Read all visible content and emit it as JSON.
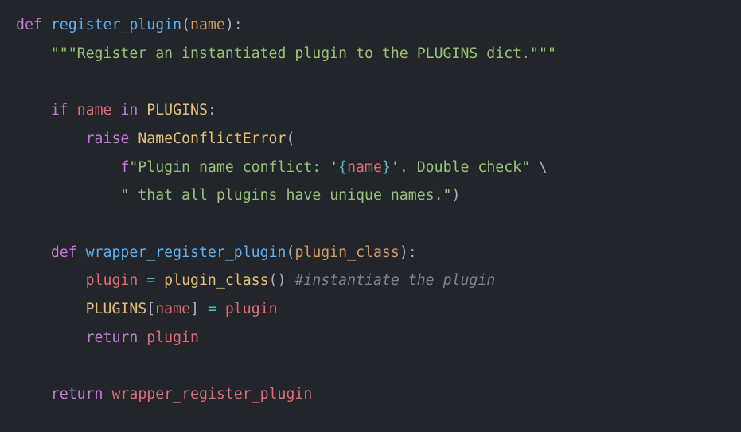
{
  "code": {
    "lines": [
      {
        "indent": 0,
        "tokens": [
          {
            "t": "def ",
            "c": "tok-kw"
          },
          {
            "t": "register_plugin",
            "c": "tok-fn"
          },
          {
            "t": "(",
            "c": "tok-punc"
          },
          {
            "t": "name",
            "c": "tok-prm"
          },
          {
            "t": "):",
            "c": "tok-punc"
          }
        ]
      },
      {
        "indent": 1,
        "tokens": [
          {
            "t": "\"\"\"Register an instantiated plugin to the PLUGINS dict.\"\"\"",
            "c": "tok-str"
          }
        ]
      },
      {
        "indent": 0,
        "tokens": []
      },
      {
        "indent": 1,
        "tokens": [
          {
            "t": "if ",
            "c": "tok-kw"
          },
          {
            "t": "name ",
            "c": "tok-name"
          },
          {
            "t": "in ",
            "c": "tok-kw"
          },
          {
            "t": "PLUGINS",
            "c": "tok-const"
          },
          {
            "t": ":",
            "c": "tok-punc"
          }
        ]
      },
      {
        "indent": 2,
        "tokens": [
          {
            "t": "raise ",
            "c": "tok-kw"
          },
          {
            "t": "NameConflictError",
            "c": "tok-const"
          },
          {
            "t": "(",
            "c": "tok-punc"
          }
        ]
      },
      {
        "indent": 3,
        "tokens": [
          {
            "t": "f",
            "c": "tok-fstr"
          },
          {
            "t": "\"Plugin name conflict: '",
            "c": "tok-str"
          },
          {
            "t": "{",
            "c": "tok-op"
          },
          {
            "t": "name",
            "c": "tok-name"
          },
          {
            "t": "}",
            "c": "tok-op"
          },
          {
            "t": "'. Double check\"",
            "c": "tok-str"
          },
          {
            "t": " \\",
            "c": "tok-punc"
          }
        ]
      },
      {
        "indent": 3,
        "tokens": [
          {
            "t": "\" that all plugins have unique names.\"",
            "c": "tok-str"
          },
          {
            "t": ")",
            "c": "tok-punc"
          }
        ]
      },
      {
        "indent": 0,
        "tokens": []
      },
      {
        "indent": 1,
        "tokens": [
          {
            "t": "def ",
            "c": "tok-kw"
          },
          {
            "t": "wrapper_register_plugin",
            "c": "tok-fn"
          },
          {
            "t": "(",
            "c": "tok-punc"
          },
          {
            "t": "plugin_class",
            "c": "tok-prm"
          },
          {
            "t": "):",
            "c": "tok-punc"
          }
        ]
      },
      {
        "indent": 2,
        "tokens": [
          {
            "t": "plugin ",
            "c": "tok-name"
          },
          {
            "t": "= ",
            "c": "tok-op"
          },
          {
            "t": "plugin_class",
            "c": "tok-const"
          },
          {
            "t": "() ",
            "c": "tok-punc"
          },
          {
            "t": "#instantiate the plugin",
            "c": "tok-cmt"
          }
        ]
      },
      {
        "indent": 2,
        "tokens": [
          {
            "t": "PLUGINS",
            "c": "tok-const"
          },
          {
            "t": "[",
            "c": "tok-punc"
          },
          {
            "t": "name",
            "c": "tok-name"
          },
          {
            "t": "] ",
            "c": "tok-punc"
          },
          {
            "t": "= ",
            "c": "tok-op"
          },
          {
            "t": "plugin",
            "c": "tok-name"
          }
        ]
      },
      {
        "indent": 2,
        "tokens": [
          {
            "t": "return ",
            "c": "tok-kw"
          },
          {
            "t": "plugin",
            "c": "tok-name"
          }
        ]
      },
      {
        "indent": 0,
        "tokens": []
      },
      {
        "indent": 1,
        "tokens": [
          {
            "t": "return ",
            "c": "tok-kw"
          },
          {
            "t": "wrapper_register_plugin",
            "c": "tok-name"
          }
        ]
      }
    ],
    "indent_unit": "    "
  }
}
